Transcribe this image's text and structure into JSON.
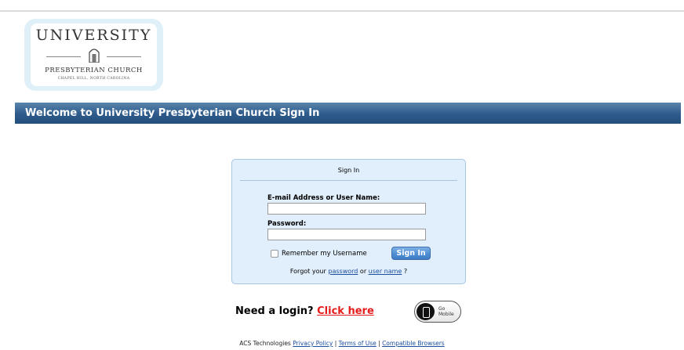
{
  "logo": {
    "line1": "UNIVERSITY",
    "line2": "PRESBYTERIAN CHURCH",
    "line3": "CHAPEL HILL, NORTH CAROLINA"
  },
  "banner": {
    "title": "Welcome to University Presbyterian Church Sign In"
  },
  "signin": {
    "title": "Sign In",
    "username_label": "E-mail Address or User Name:",
    "username_value": "",
    "password_label": "Password:",
    "password_value": "",
    "remember_label": "Remember my Username",
    "submit_label": "Sign In",
    "forgot_prefix": "Forgot your ",
    "forgot_password": "password",
    "forgot_or": " or ",
    "forgot_username": "user name",
    "forgot_suffix": " ?"
  },
  "need_login": {
    "text": "Need a login? ",
    "link": "Click here"
  },
  "go_mobile": {
    "line1": "Go",
    "line2": "Mobile",
    "icon": "phone-icon"
  },
  "footer": {
    "vendor": "ACS Technologies ",
    "privacy": "Privacy Policy",
    "sep1": " | ",
    "terms": "Terms of Use",
    "sep2": " | ",
    "browsers": "Compatible Browsers"
  },
  "colors": {
    "banner": "#2d5a8a",
    "panel": "#e1eefb",
    "link": "#1d4fa0",
    "click_here": "#e51b1b",
    "button": "#4f8ed4"
  }
}
